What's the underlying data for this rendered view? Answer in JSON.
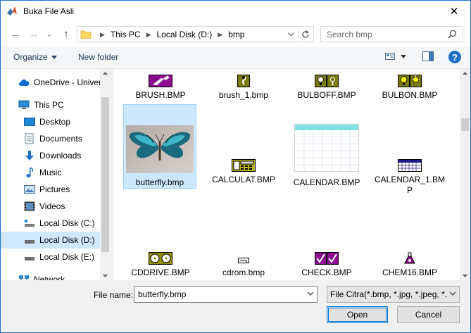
{
  "window": {
    "title": "Buka File Asli",
    "close_glyph": "✕"
  },
  "nav": {
    "back_glyph": "←",
    "forward_glyph": "→",
    "recent_glyph": "⌄",
    "up_glyph": "↑",
    "breadcrumbs": [
      "This PC",
      "Local Disk (D:)",
      "bmp"
    ],
    "search_placeholder": "Search bmp"
  },
  "toolbar": {
    "organize_label": "Organize",
    "new_folder_label": "New folder",
    "help_glyph": "?"
  },
  "sidebar": {
    "items": [
      {
        "label": "OneDrive - Univer",
        "icon": "cloud-icon"
      },
      {
        "label": "This PC",
        "icon": "computer-icon"
      },
      {
        "label": "Desktop",
        "icon": "desktop-icon"
      },
      {
        "label": "Documents",
        "icon": "documents-icon"
      },
      {
        "label": "Downloads",
        "icon": "downloads-icon"
      },
      {
        "label": "Music",
        "icon": "music-icon"
      },
      {
        "label": "Pictures",
        "icon": "pictures-icon"
      },
      {
        "label": "Videos",
        "icon": "videos-icon"
      },
      {
        "label": "Local Disk (C:)",
        "icon": "drive-icon"
      },
      {
        "label": "Local Disk (D:)",
        "icon": "drive-icon"
      },
      {
        "label": "Local Disk (E:)",
        "icon": "drive-icon"
      },
      {
        "label": "Network",
        "icon": "network-icon"
      }
    ],
    "selected": "Local Disk (D:)"
  },
  "files": [
    {
      "name": "BRUSH.BMP",
      "icon": "brush-icon"
    },
    {
      "name": "brush_1.bmp",
      "icon": "brush-small-icon"
    },
    {
      "name": "BULBOFF.BMP",
      "icon": "bulb-off-icon"
    },
    {
      "name": "BULBON.BMP",
      "icon": "bulb-on-icon"
    },
    {
      "name": "butterfly.bmp",
      "icon": "butterfly-photo"
    },
    {
      "name": "CALCULAT.BMP",
      "icon": "calculator-icon"
    },
    {
      "name": "CALENDAR.BMP",
      "icon": "calendar-icon"
    },
    {
      "name": "CALENDAR_1.BMP",
      "icon": "calendar-small-icon"
    },
    {
      "name": "CDDRIVE.BMP",
      "icon": "cd-drive-icon"
    },
    {
      "name": "cdrom.bmp",
      "icon": "cdrom-icon"
    },
    {
      "name": "CHECK.BMP",
      "icon": "check-icon"
    },
    {
      "name": "CHEM16.BMP",
      "icon": "flask-icon"
    }
  ],
  "selected_file": "butterfly.bmp",
  "bottom": {
    "file_name_label": "File name:",
    "file_name_value": "butterfly.bmp",
    "filter_value": "File Citra(*.bmp, *.jpg, *.jpeg, *.",
    "open_label": "Open",
    "cancel_label": "Cancel"
  }
}
